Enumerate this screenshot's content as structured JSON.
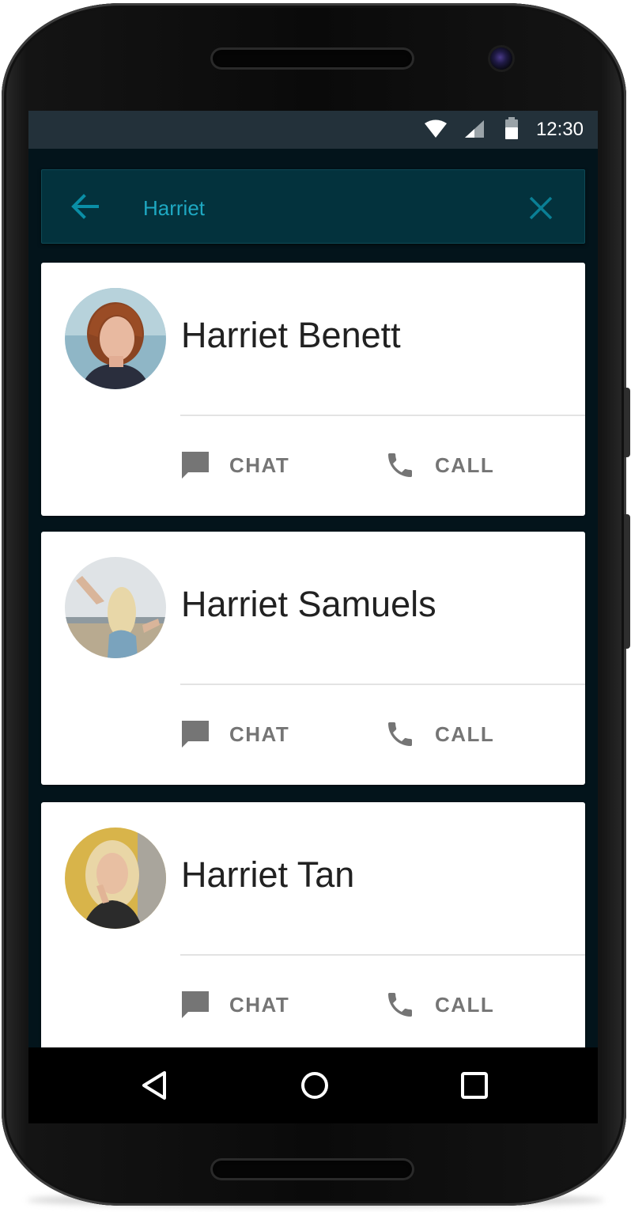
{
  "status_bar": {
    "time": "12:30",
    "icons": [
      "wifi-icon",
      "cell-signal-icon",
      "battery-icon"
    ]
  },
  "search": {
    "query": "Harriet",
    "back_icon": "arrow-left-icon",
    "clear_icon": "close-icon",
    "accent_color": "#1ea8c2"
  },
  "results": [
    {
      "name": "Harriet Benett",
      "chat_label": "CHAT",
      "call_label": "CALL"
    },
    {
      "name": "Harriet Samuels",
      "chat_label": "CHAT",
      "call_label": "CALL"
    },
    {
      "name": "Harriet Tan",
      "chat_label": "CHAT",
      "call_label": "CALL"
    }
  ],
  "nav_bar": {
    "back_icon": "triangle-back-icon",
    "home_icon": "circle-home-icon",
    "recents_icon": "square-recents-icon"
  },
  "colors": {
    "screen_background": "#03141b",
    "status_bar": "#23313a",
    "search_bar": "#03323d",
    "card": "#ffffff",
    "action_text": "#757575"
  }
}
